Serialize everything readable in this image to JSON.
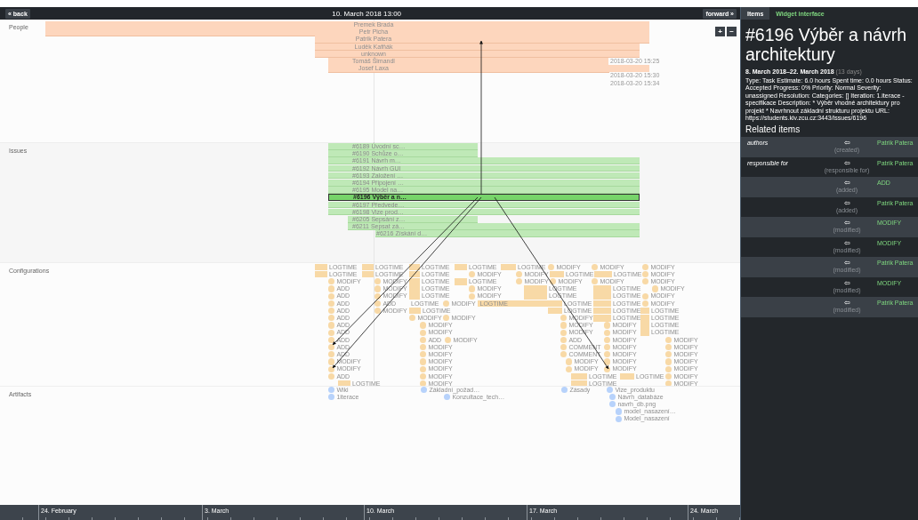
{
  "nav": {
    "back": "« back",
    "title": "10. March 2018 13:00",
    "forward": "forward »"
  },
  "zoom_buttons": [
    "+",
    "−"
  ],
  "people": {
    "label": "People",
    "rows": [
      {
        "name": "Premek Brada"
      },
      {
        "name": "Petr Picha"
      },
      {
        "name": "Patrik Patera"
      },
      {
        "name": "Luděk Kafňák"
      },
      {
        "name": "unknown"
      },
      {
        "name": "Tomáš Šimandl"
      },
      {
        "name": "Josef Laxa"
      }
    ],
    "timestamps": [
      "2018-03-20 15:25",
      "2018-03-20 15:30",
      "2018-03-20 15:34"
    ]
  },
  "issues": {
    "label": "Issues",
    "rows": [
      {
        "title": "#6189 Úvodní sc…",
        "selected": false
      },
      {
        "title": "#6190 Schůze o…",
        "selected": false
      },
      {
        "title": "#6191 Návrh m…",
        "selected": false
      },
      {
        "title": "#6192 Návrh GUI",
        "selected": false
      },
      {
        "title": "#6193 Založení …",
        "selected": false
      },
      {
        "title": "#6194 Připojení …",
        "selected": false
      },
      {
        "title": "#6195 Model na…",
        "selected": false
      },
      {
        "title": "#6196 Výběr a n…",
        "selected": true
      },
      {
        "title": "#6197 Předvede…",
        "selected": false
      },
      {
        "title": "#6198 Vize prod…",
        "selected": false
      },
      {
        "title": "#6205 Sepsání z…",
        "selected": false
      },
      {
        "title": "#6211 Sepsat zá…",
        "selected": false
      },
      {
        "title": "#6216 Získání d…",
        "selected": false
      }
    ]
  },
  "configurations": {
    "label": "Configurations",
    "columns": [
      {
        "items": [
          {
            "kind": "logtime",
            "label": "LOGTIME"
          },
          {
            "kind": "logtime",
            "label": "LOGTIME"
          }
        ]
      },
      {
        "items": [
          {
            "kind": "change",
            "label": "MODIFY"
          },
          {
            "kind": "change",
            "label": "ADD"
          },
          {
            "kind": "change",
            "label": "ADD"
          },
          {
            "kind": "change",
            "label": "ADD"
          },
          {
            "kind": "change",
            "label": "ADD"
          },
          {
            "kind": "change",
            "label": "ADD"
          },
          {
            "kind": "change",
            "label": "ADD"
          },
          {
            "kind": "change",
            "label": "ADD"
          },
          {
            "kind": "change",
            "label": "ADD"
          },
          {
            "kind": "change",
            "label": "ADD"
          },
          {
            "kind": "change",
            "label": "ADD"
          },
          {
            "kind": "change",
            "label": "MODIFY"
          },
          {
            "kind": "change",
            "label": "MODIFY"
          },
          {
            "kind": "change",
            "label": "ADD"
          }
        ]
      },
      {
        "items": [
          {
            "kind": "logtime",
            "label": "LOGTIME"
          },
          {
            "kind": "logtime",
            "label": "LOGTIME"
          }
        ]
      },
      {
        "items": [
          {
            "kind": "change",
            "label": "MODIFY"
          },
          {
            "kind": "change",
            "label": "MODIFY"
          },
          {
            "kind": "change",
            "label": "MODIFY"
          },
          {
            "kind": "change",
            "label": "ADD"
          },
          {
            "kind": "change",
            "label": "MODIFY"
          }
        ]
      },
      {
        "items": [
          {
            "kind": "logtime",
            "label": "LOGTIME"
          }
        ]
      },
      {
        "items": [
          {
            "kind": "logtime",
            "label": "LOGTIME"
          },
          {
            "kind": "logtime",
            "label": "LOGTIME"
          },
          {
            "kind": "logtime",
            "label": "LOGTIME"
          },
          {
            "kind": "logtime",
            "label": "LOGTIME"
          },
          {
            "kind": "logtime",
            "label": "LOGTIME"
          }
        ]
      },
      {
        "items": [
          {
            "kind": "logtime",
            "label": "LOGTIME"
          }
        ]
      },
      {
        "items": [
          {
            "kind": "logtime",
            "label": "LOGTIME"
          }
        ]
      },
      {
        "items": [
          {
            "kind": "change",
            "label": "MODIFY"
          }
        ]
      },
      {
        "items": [
          {
            "kind": "change",
            "label": "MODIFY"
          },
          {
            "kind": "change",
            "label": "MODIFY"
          },
          {
            "kind": "change",
            "label": "ADD"
          },
          {
            "kind": "change",
            "label": "MODIFY"
          },
          {
            "kind": "change",
            "label": "MODIFY"
          },
          {
            "kind": "change",
            "label": "MODIFY"
          },
          {
            "kind": "change",
            "label": "MODIFY"
          },
          {
            "kind": "change",
            "label": "MODIFY"
          },
          {
            "kind": "change",
            "label": "MODIFY"
          }
        ]
      },
      {
        "items": [
          {
            "kind": "change",
            "label": "MODIFY"
          }
        ]
      },
      {
        "items": [
          {
            "kind": "change",
            "label": "MODIFY"
          }
        ]
      },
      {
        "items": [
          {
            "kind": "change",
            "label": "MODIFY"
          }
        ]
      },
      {
        "items": [
          {
            "kind": "logtime",
            "label": "LOGTIME"
          }
        ]
      },
      {
        "items": [
          {
            "kind": "change",
            "label": "MODIFY"
          }
        ]
      },
      {
        "items": [
          {
            "kind": "logtime",
            "label": "LOGTIME"
          }
        ]
      },
      {
        "items": [
          {
            "kind": "change",
            "label": "MODIFY"
          },
          {
            "kind": "change",
            "label": "MODIFY"
          }
        ]
      },
      {
        "items": [
          {
            "kind": "logtime",
            "label": "LOGTIME"
          }
        ]
      },
      {
        "items": [
          {
            "kind": "logtime",
            "label": "LOGTIME"
          }
        ]
      },
      {
        "items": [
          {
            "kind": "change",
            "label": "MODIFY"
          },
          {
            "kind": "change",
            "label": "MODIFY"
          }
        ]
      },
      {
        "items": [
          {
            "kind": "change",
            "label": "MODIFY"
          }
        ]
      },
      {
        "items": [
          {
            "kind": "logtime",
            "label": "LOGTIME"
          }
        ]
      },
      {
        "items": [
          {
            "kind": "change",
            "label": "MODIFY"
          }
        ]
      },
      {
        "items": [
          {
            "kind": "logtime",
            "label": "LOGTIME"
          },
          {
            "kind": "logtime",
            "label": "LOGTIME"
          }
        ]
      },
      {
        "items": [
          {
            "kind": "logtime",
            "label": "LOGTIME"
          },
          {
            "kind": "logtime",
            "label": "LOGTIME"
          }
        ]
      },
      {
        "items": [
          {
            "kind": "change",
            "label": "MODIFY"
          },
          {
            "kind": "change",
            "label": "MODIFY"
          },
          {
            "kind": "change",
            "label": "MODIFY"
          },
          {
            "kind": "change",
            "label": "ADD"
          },
          {
            "kind": "change",
            "label": "COMMENT"
          },
          {
            "kind": "change",
            "label": "COMMENT"
          }
        ]
      },
      {
        "items": [
          {
            "kind": "change",
            "label": "MODIFY"
          },
          {
            "kind": "change",
            "label": "MODIFY"
          }
        ]
      },
      {
        "items": [
          {
            "kind": "change",
            "label": "MODIFY"
          }
        ]
      },
      {
        "items": [
          {
            "kind": "logtime",
            "label": "LOGTIME"
          }
        ]
      },
      {
        "items": [
          {
            "kind": "change",
            "label": "MODIFY"
          }
        ]
      },
      {
        "items": [
          {
            "kind": "logtime",
            "label": "LOGTIME"
          },
          {
            "kind": "logtime",
            "label": "LOGTIME"
          },
          {
            "kind": "logtime",
            "label": "LOGTIME"
          },
          {
            "kind": "logtime",
            "label": "LOGTIME"
          },
          {
            "kind": "logtime",
            "label": "LOGTIME"
          }
        ]
      },
      {
        "items": [
          {
            "kind": "change",
            "label": "MODIFY"
          },
          {
            "kind": "change",
            "label": "MODIFY"
          },
          {
            "kind": "change",
            "label": "MODIFY"
          },
          {
            "kind": "change",
            "label": "MODIFY"
          },
          {
            "kind": "change",
            "label": "MODIFY"
          },
          {
            "kind": "change",
            "label": "MODIFY"
          },
          {
            "kind": "change",
            "label": "MODIFY"
          }
        ]
      },
      {
        "items": [
          {
            "kind": "logtime",
            "label": "LOGTIME"
          },
          {
            "kind": "logtime",
            "label": "LOGTIME"
          }
        ]
      },
      {
        "items": [
          {
            "kind": "change",
            "label": "MODIFY"
          },
          {
            "kind": "change",
            "label": "MODIFY"
          },
          {
            "kind": "change",
            "label": "MODIFY"
          }
        ]
      },
      {
        "items": [
          {
            "kind": "change",
            "label": "MODIFY"
          }
        ]
      },
      {
        "items": [
          {
            "kind": "change",
            "label": "MODIFY"
          },
          {
            "kind": "change",
            "label": "MODIFY"
          }
        ]
      },
      {
        "items": [
          {
            "kind": "logtime",
            "label": "LOGTIME"
          },
          {
            "kind": "logtime",
            "label": "LOGTIME"
          },
          {
            "kind": "logtime",
            "label": "LOGTIME"
          },
          {
            "kind": "logtime",
            "label": "LOGTIME"
          }
        ]
      },
      {
        "items": [
          {
            "kind": "logtime",
            "label": "LOGTIME"
          }
        ]
      },
      {
        "items": [
          {
            "kind": "change",
            "label": "MODIFY"
          },
          {
            "kind": "change",
            "label": "MODIFY"
          },
          {
            "kind": "change",
            "label": "MODIFY"
          },
          {
            "kind": "change",
            "label": "MODIFY"
          },
          {
            "kind": "change",
            "label": "MODIFY"
          },
          {
            "kind": "change",
            "label": "MODIFY"
          },
          {
            "kind": "change",
            "label": "MODIFY"
          }
        ]
      }
    ]
  },
  "artifacts": {
    "label": "Artifacts",
    "items": [
      {
        "name": "Wiki"
      },
      {
        "name": "1iterace"
      },
      {
        "name": "Základní_požad…"
      },
      {
        "name": "Konzultace_tech…"
      },
      {
        "name": "Zásady"
      },
      {
        "name": "Vize_produktu"
      },
      {
        "name": "Návrh_databáze"
      },
      {
        "name": "navrh_db.png"
      },
      {
        "name": "model_nasazení…"
      },
      {
        "name": "Model_nasazení"
      }
    ]
  },
  "axis": {
    "labels": [
      "24. February",
      "3. March",
      "10. March",
      "17. March",
      "24. March"
    ]
  },
  "panel": {
    "tabs": [
      {
        "label": "Items",
        "selected": true
      },
      {
        "label": "Widget interface",
        "selected": false
      }
    ],
    "title": "#6196 Výběr a návrh architektury",
    "dates": "8. March 2018–22. March 2018",
    "duration": "(13 days)",
    "description": "Type: Task Estimate: 6.0 hours Spent time: 0.0 hours Status: Accepted Progress: 0% Priority: Normal Severity: unassigned Resolution: Categories: [] Iteration: 1.iterace - specifikace Description: * Výběr vhodné architektury pro projekt * Navrhnout základní strukturu projektu URL: https://students.kiv.zcu.cz:3443/issues/6196",
    "related_title": "Related items",
    "related": [
      {
        "role": "authors",
        "arrow": "⇦",
        "relation": "(created)",
        "target": "Patrik Patera"
      },
      {
        "role": "responsible for",
        "arrow": "⇦",
        "relation": "(responsible for)",
        "target": "Patrik Patera"
      },
      {
        "arrow": "⇦",
        "relation": "(added)",
        "target": "ADD"
      },
      {
        "arrow": "⇦",
        "relation": "(added)",
        "target": "Patrik Patera"
      },
      {
        "arrow": "⇦",
        "relation": "(modified)",
        "target": "MODIFY"
      },
      {
        "arrow": "⇦",
        "relation": "(modified)",
        "target": "MODIFY"
      },
      {
        "arrow": "⇦",
        "relation": "(modified)",
        "target": "Patrik Patera"
      },
      {
        "arrow": "⇦",
        "relation": "(modified)",
        "target": "MODIFY"
      },
      {
        "arrow": "⇦",
        "relation": "(modified)",
        "target": "Patrik Patera"
      }
    ]
  }
}
